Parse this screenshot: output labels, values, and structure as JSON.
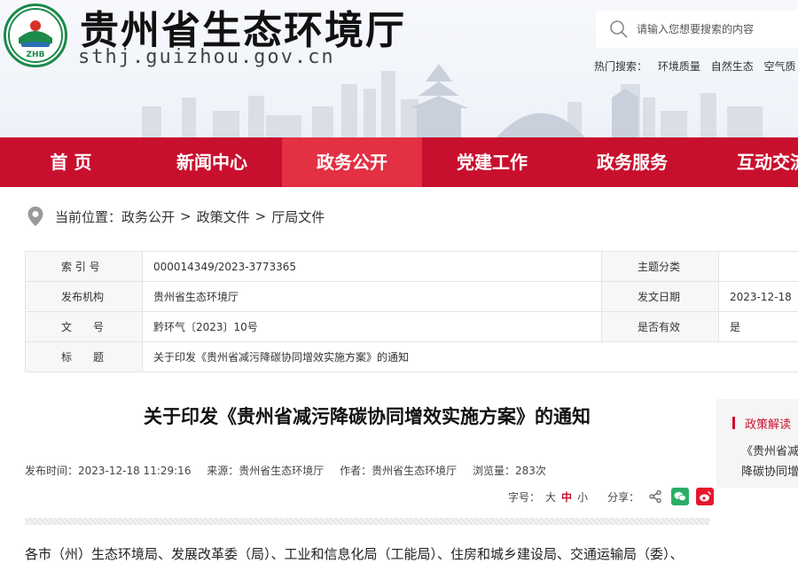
{
  "header": {
    "site_name": "贵州省生态环境厅",
    "site_domain": "sthj.guizhou.gov.cn",
    "logo_text": "ZHB"
  },
  "search": {
    "placeholder": "请输入您想要搜索的内容",
    "hot_label": "热门搜索：",
    "hot_keywords": [
      "环境质量",
      "自然生态",
      "空气质"
    ]
  },
  "nav": {
    "items": [
      "首 页",
      "新闻中心",
      "政务公开",
      "党建工作",
      "政务服务",
      "互动交流"
    ],
    "active": 2
  },
  "breadcrumb": {
    "label": "当前位置：",
    "items": [
      "政务公开",
      "政策文件",
      "厅局文件"
    ],
    "separator": ">"
  },
  "meta": {
    "rows": [
      {
        "k1": "索 引 号",
        "v1": "000014349/2023-3773365",
        "k2": "主题分类",
        "v2": ""
      },
      {
        "k1": "发布机构",
        "v1": "贵州省生态环境厅",
        "k2": "发文日期",
        "v2": "2023-12-18"
      },
      {
        "k1": "文　　号",
        "v1": "黔环气〔2023〕10号",
        "k2": "是否有效",
        "v2": "是"
      },
      {
        "k1": "标　　题",
        "v1": "关于印发《贵州省减污降碳协同增效实施方案》的通知",
        "k2": "",
        "v2": ""
      }
    ]
  },
  "article": {
    "title": "关于印发《贵州省减污降碳协同增效实施方案》的通知",
    "published": "发布时间：2023-12-18 11:29:16",
    "source": "来源：贵州省生态环境厅",
    "author": "作者：贵州省生态环境厅",
    "views": "浏览量：283次",
    "font_label": "字号：",
    "font_large": "大",
    "font_medium": "中",
    "font_small": "小",
    "share_label": "分享：",
    "body_first_line": "各市（州）生态环境局、发展改革委（局）、工业和信息化局（工能局）、住房和城乡建设局、交通运输局（委）、"
  },
  "side": {
    "title": "政策解读",
    "link": "《贵州省减污降碳协同增效实施方案》政策解读"
  },
  "colors": {
    "nav_red": "#c8102e",
    "nav_active": "#e33043",
    "wechat_green": "#2aae67",
    "weibo_red": "#e6162d"
  }
}
